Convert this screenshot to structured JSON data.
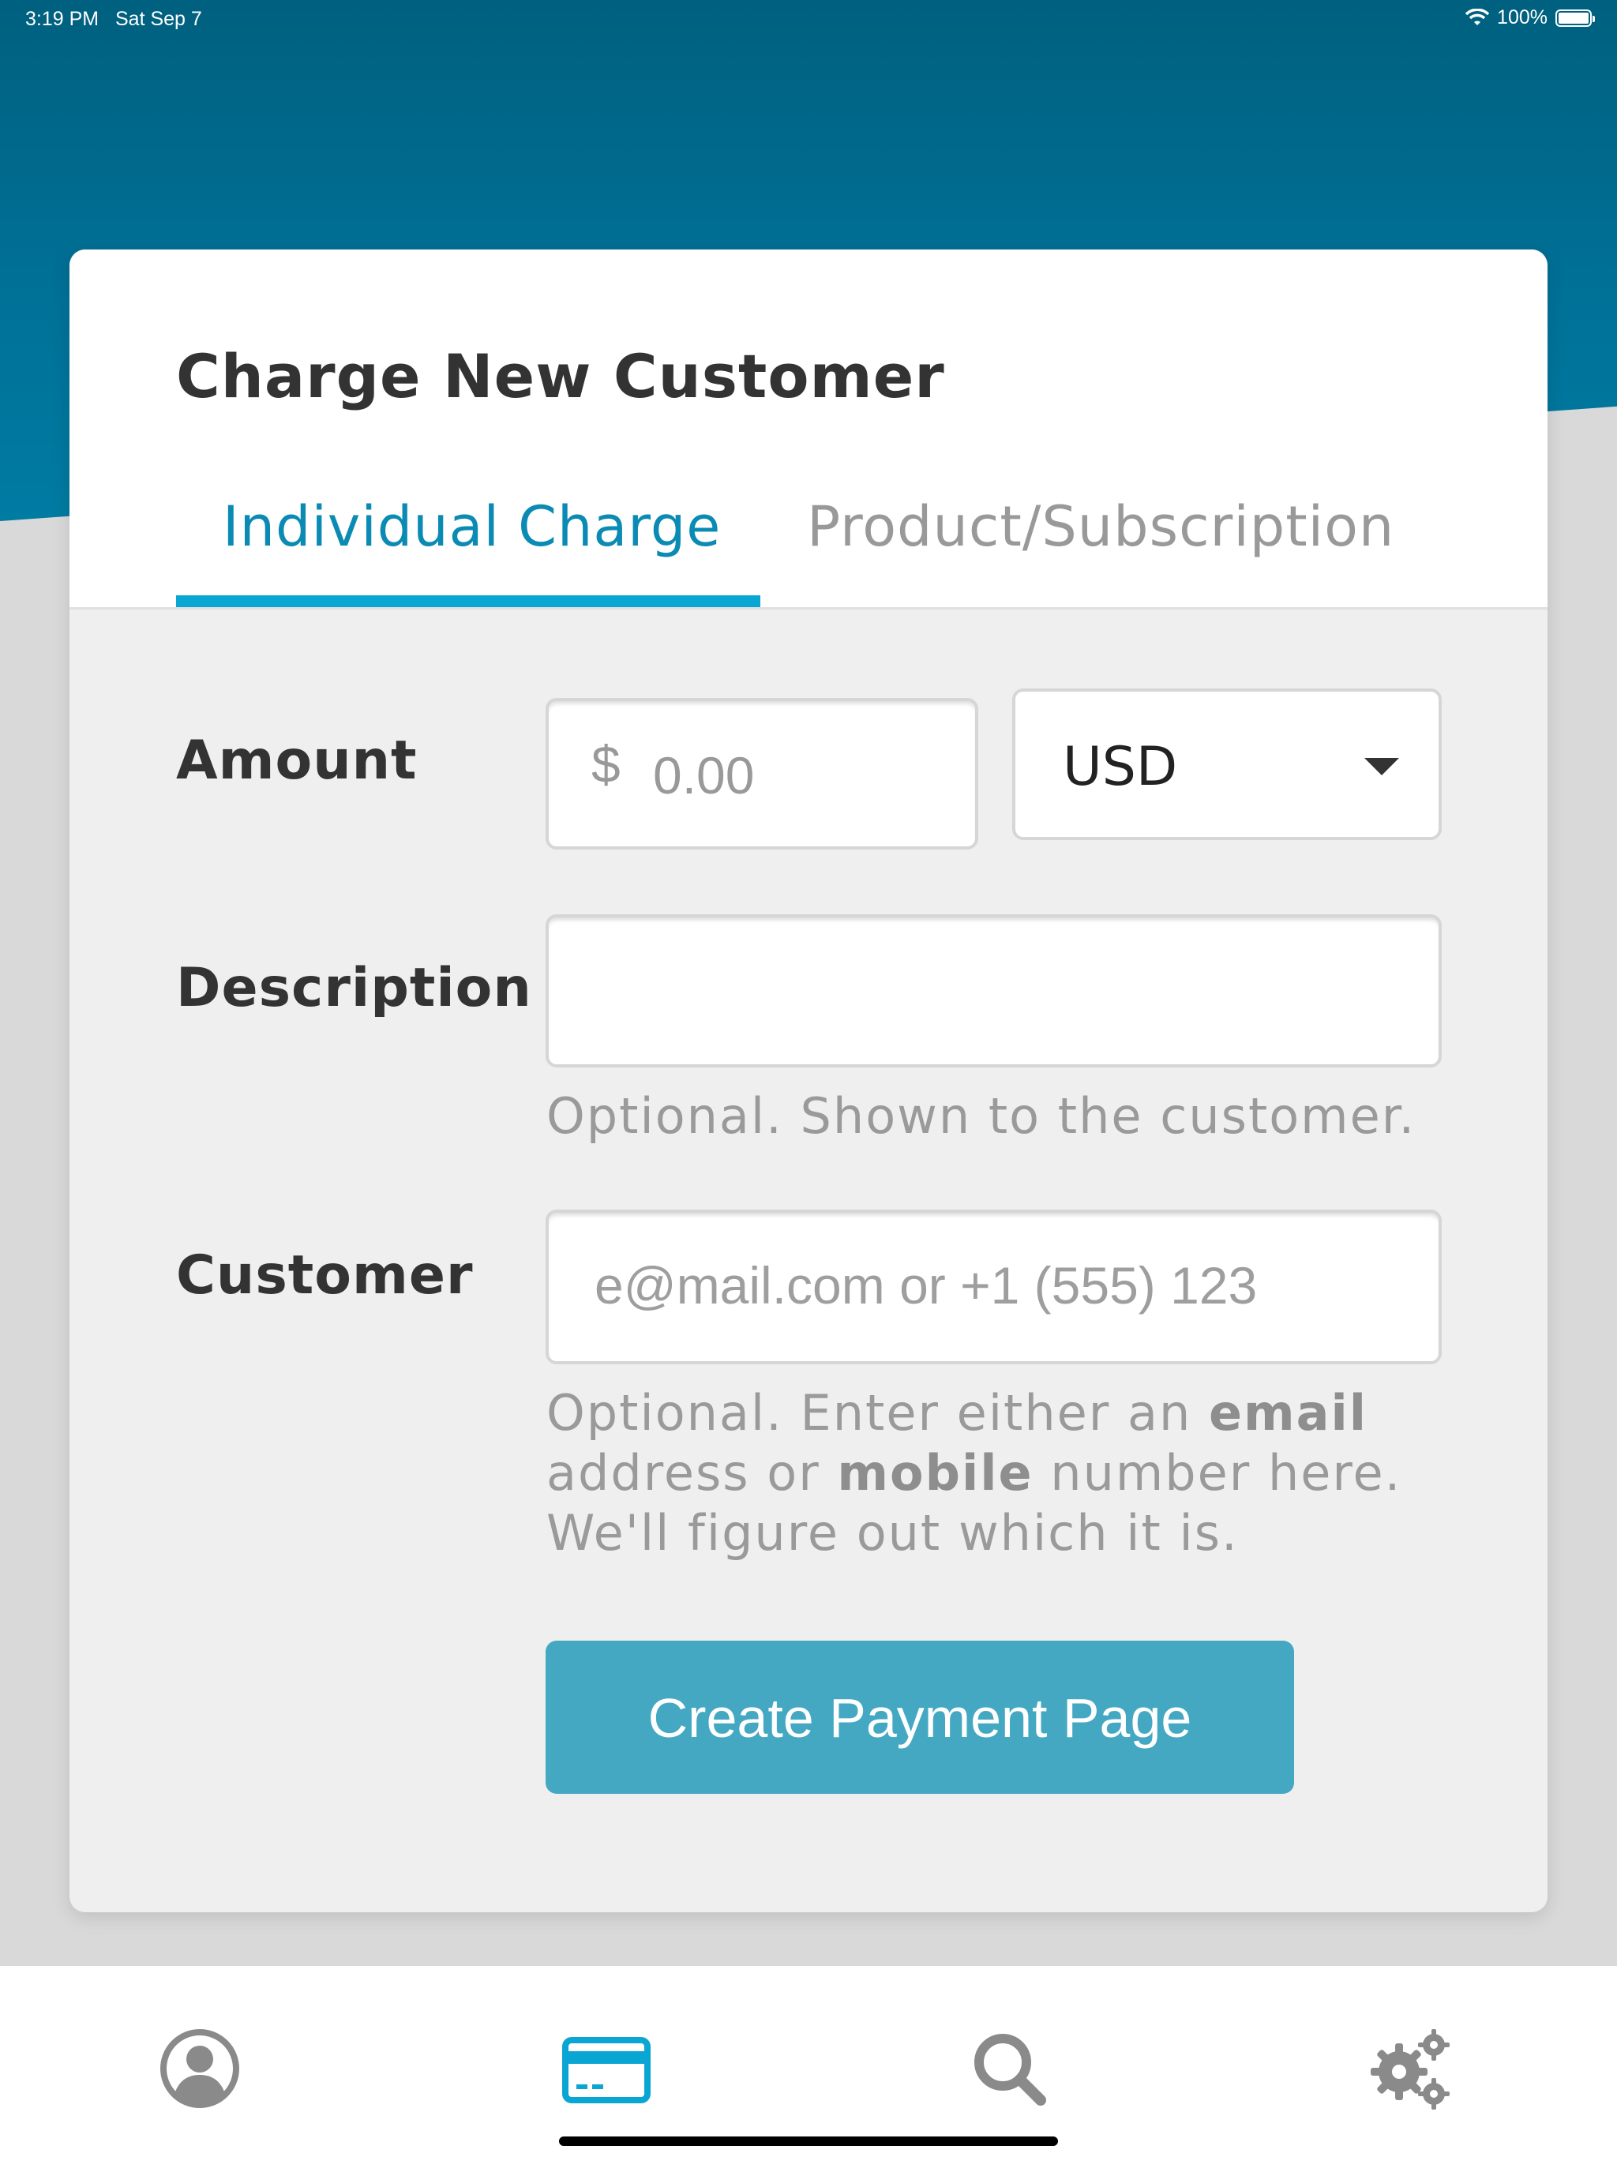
{
  "status_bar": {
    "time": "3:19 PM",
    "date": "Sat Sep 7",
    "battery": "100%"
  },
  "card": {
    "title": "Charge New Customer",
    "tabs": [
      {
        "label": "Individual Charge",
        "active": true
      },
      {
        "label": "Product/Subscription",
        "active": false
      }
    ]
  },
  "form": {
    "amount_label": "Amount",
    "currency_symbol": "$",
    "amount_placeholder": "0.00",
    "currency_value": "USD",
    "description_label": "Description",
    "description_help": "Optional. Shown to the customer.",
    "customer_label": "Customer",
    "customer_placeholder": "e@mail.com or +1 (555) 123",
    "customer_help": {
      "part1": "Optional. Enter either an ",
      "bold1": "email",
      "part2": " address or ",
      "bold2": "mobile",
      "part3": " number here. We'll figure out which it is."
    },
    "submit_label": "Create Payment Page"
  },
  "tab_bar": {
    "items": [
      {
        "icon": "account-icon",
        "active": false
      },
      {
        "icon": "credit-card-icon",
        "active": true
      },
      {
        "icon": "search-icon",
        "active": false
      },
      {
        "icon": "settings-gears-icon",
        "active": false
      }
    ]
  },
  "colors": {
    "accent": "#0aa6d3",
    "header": "#006f95",
    "button": "#44a8c2",
    "inactive_icon": "#8a8a8a"
  }
}
